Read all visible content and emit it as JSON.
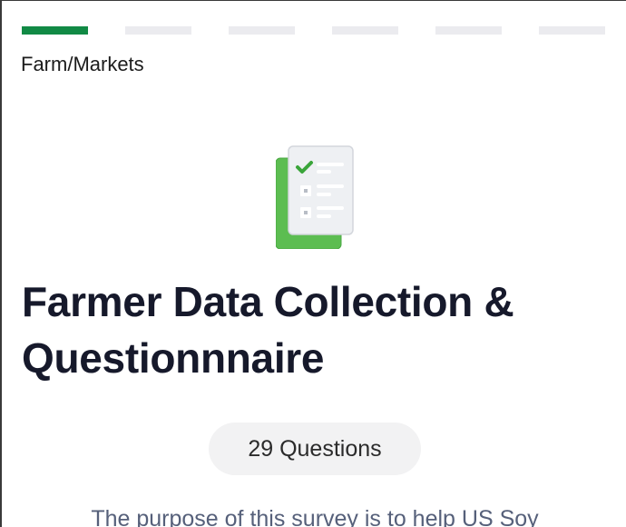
{
  "survey": {
    "category": "Farm/Markets",
    "title": "Farmer Data Collection & Questionnnaire",
    "question_count_label": "29 Questions",
    "description": "The purpose of this survey is to help US Soy"
  },
  "progress": {
    "total_steps": 6,
    "current_step": 1,
    "active_color": "#118a45",
    "inactive_color": "#ebebef"
  },
  "icons": {
    "hero": "checklist-clipboard-icon"
  },
  "colors": {
    "title": "#16192b",
    "clipboard_green": "#5cbd51",
    "check_green": "#3aa53a"
  }
}
